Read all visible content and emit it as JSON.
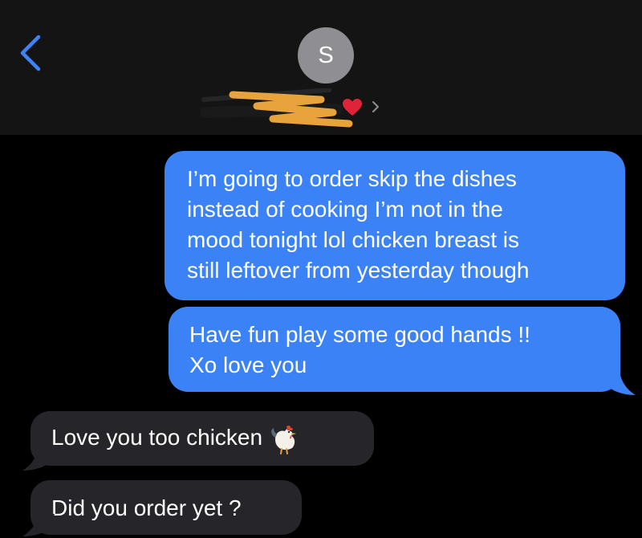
{
  "header": {
    "avatar_initial": "S"
  },
  "messages": [
    {
      "direction": "sent",
      "lines": [
        "I’m going to order skip the dishes",
        "instead of cooking I’m not in the",
        "mood tonight lol chicken breast is",
        "still leftover from yesterday though"
      ]
    },
    {
      "direction": "sent",
      "lines": [
        "Have fun play some good hands !!",
        "Xo love you"
      ]
    },
    {
      "direction": "received",
      "text": "Love you too chicken"
    },
    {
      "direction": "received",
      "text": "Did you order yet ?"
    }
  ],
  "icons": {
    "back": "chevron-left-icon",
    "contact_details": "chevron-right-icon",
    "heart": "red-heart-icon",
    "emoji": "rooster-icon",
    "redaction": "scribble-redaction-icon"
  },
  "colors": {
    "sent_bubble": "#3b82f6",
    "received_bubble": "#26262a",
    "accent": "#3f83f8",
    "background": "#000000",
    "header": "#141414"
  }
}
